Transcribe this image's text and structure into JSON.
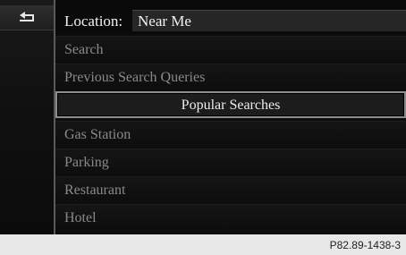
{
  "header": {
    "back_icon": "back-arrow-icon",
    "location_label": "Location:",
    "location_value": "Near Me"
  },
  "menu": {
    "items": [
      {
        "label": "Search",
        "highlighted": false
      },
      {
        "label": "Previous Search Queries",
        "highlighted": false
      },
      {
        "label": "Popular Searches",
        "highlighted": true
      },
      {
        "label": "Gas Station",
        "highlighted": false
      },
      {
        "label": "Parking",
        "highlighted": false
      },
      {
        "label": "Restaurant",
        "highlighted": false
      },
      {
        "label": "Hotel",
        "highlighted": false
      }
    ]
  },
  "footer": {
    "figure_code": "P82.89-1438-3"
  },
  "colors": {
    "background": "#0c0c0c",
    "text_active": "#f2f2f2",
    "text_inactive": "#8a8a8a",
    "highlight_border": "#8c8c8c",
    "footer_bg": "#e8e8e8"
  }
}
